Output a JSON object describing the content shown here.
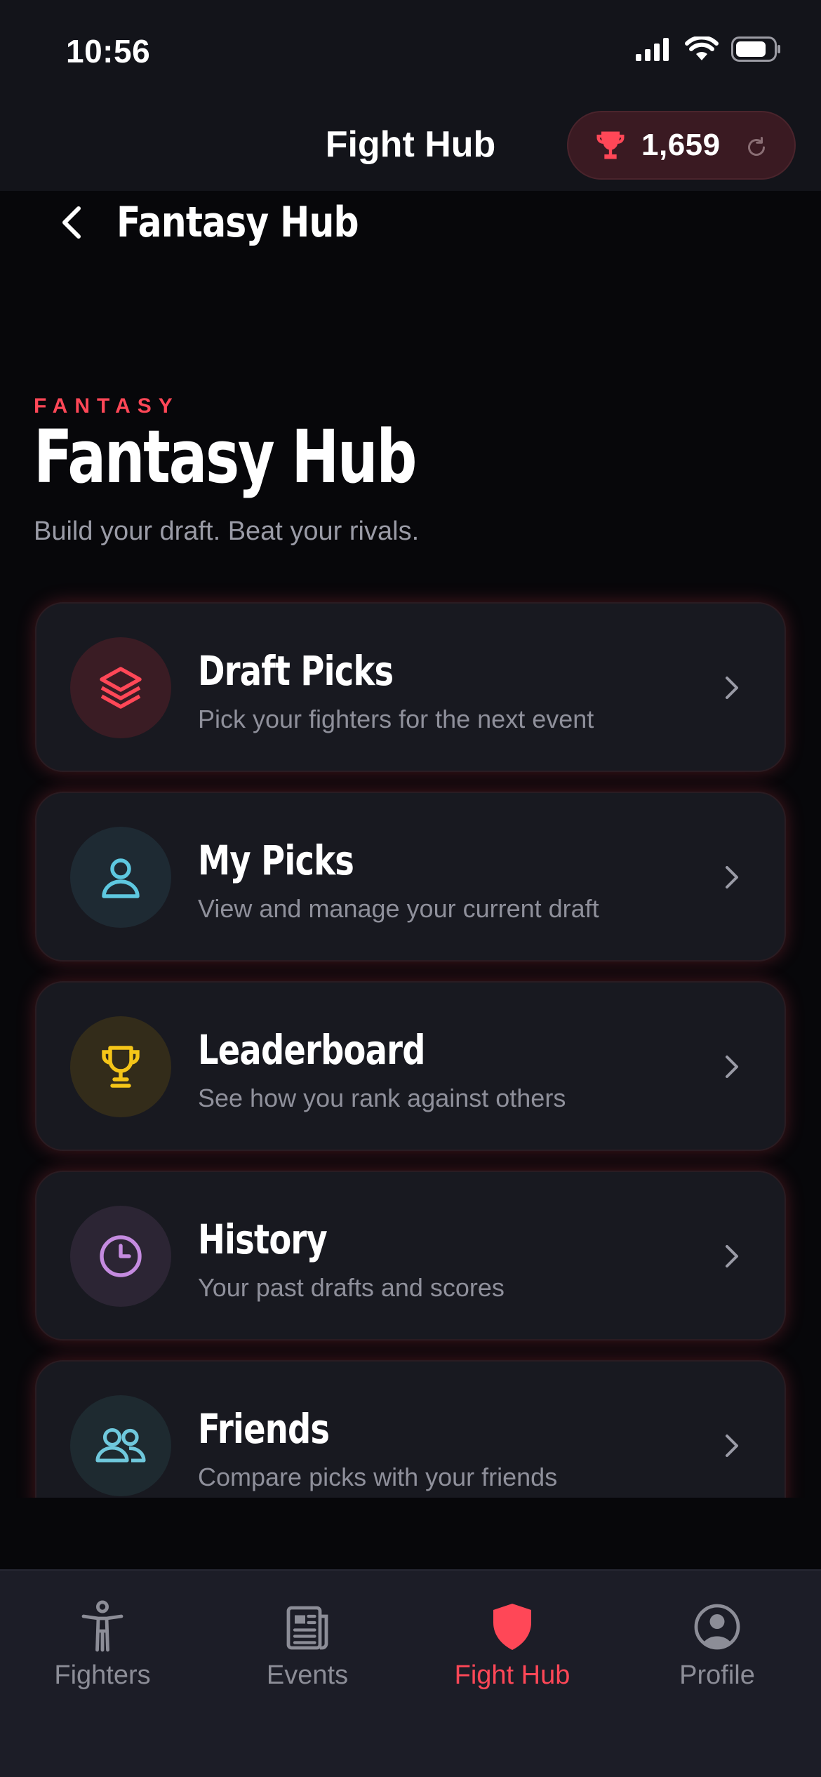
{
  "status_bar": {
    "time": "10:56"
  },
  "header": {
    "title": "Fight Hub",
    "points": "1,659"
  },
  "back": {
    "label": "Fantasy Hub"
  },
  "hero": {
    "eyebrow": "FANTASY",
    "title": "Fantasy Hub",
    "subtitle": "Build your draft. Beat your rivals."
  },
  "cards": [
    {
      "title": "Draft Picks",
      "description": "Pick your fighters for the next event",
      "icon": "layers-icon",
      "color": "#ff4757"
    },
    {
      "title": "My Picks",
      "description": "View and manage your current draft",
      "icon": "user-icon",
      "color": "#5ec8e0"
    },
    {
      "title": "Leaderboard",
      "description": "See how you rank against others",
      "icon": "trophy-icon",
      "color": "#f5c518"
    },
    {
      "title": "History",
      "description": "Your past drafts and scores",
      "icon": "clock-icon",
      "color": "#c58be0"
    },
    {
      "title": "Friends",
      "description": "Compare picks with your friends",
      "icon": "users-icon",
      "color": "#6fc8dc"
    }
  ],
  "bottom_nav": [
    {
      "label": "Fighters",
      "icon": "fighter-icon",
      "active": false
    },
    {
      "label": "Events",
      "icon": "newspaper-icon",
      "active": false
    },
    {
      "label": "Fight Hub",
      "icon": "shield-icon",
      "active": true
    },
    {
      "label": "Profile",
      "icon": "profile-icon",
      "active": false
    }
  ],
  "colors": {
    "accent": "#ff4757",
    "background": "#07070a",
    "card": "#181920",
    "nav": "#1c1d27"
  }
}
